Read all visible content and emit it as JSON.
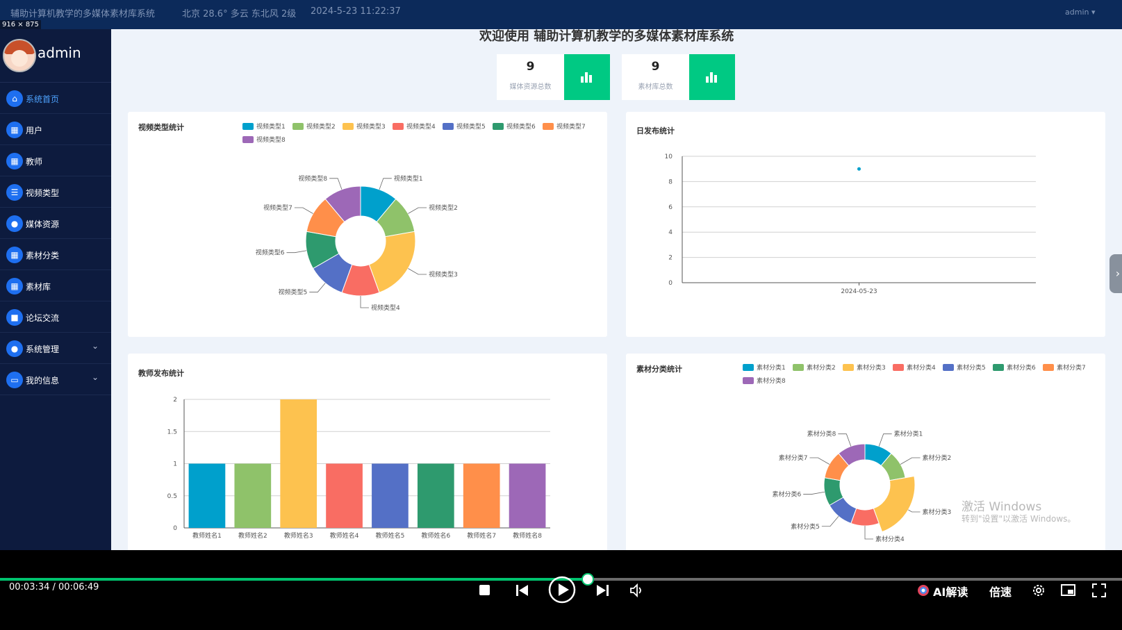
{
  "topbar": {
    "title": "辅助计算机教学的多媒体素材库系统",
    "weather": "北京  28.6°  多云  东北风  2级",
    "datetime": "2024-5-23  11:22:37",
    "user_menu": "admin ▾",
    "dimension_label": "916 × 875"
  },
  "sidebar": {
    "username": "admin",
    "items": [
      {
        "label": "系统首页",
        "icon": "home-icon",
        "glyph": "⌂",
        "active": true,
        "expandable": false
      },
      {
        "label": "用户",
        "icon": "grid-icon",
        "glyph": "▦",
        "active": false,
        "expandable": false
      },
      {
        "label": "教师",
        "icon": "grid-icon",
        "glyph": "▦",
        "active": false,
        "expandable": false
      },
      {
        "label": "视频类型",
        "icon": "list-icon",
        "glyph": "☰",
        "active": false,
        "expandable": false
      },
      {
        "label": "媒体资源",
        "icon": "person-icon",
        "glyph": "●",
        "active": false,
        "expandable": false
      },
      {
        "label": "素材分类",
        "icon": "grid-icon",
        "glyph": "▦",
        "active": false,
        "expandable": false
      },
      {
        "label": "素材库",
        "icon": "grid-icon",
        "glyph": "▦",
        "active": false,
        "expandable": false
      },
      {
        "label": "论坛交流",
        "icon": "briefcase-icon",
        "glyph": "■",
        "active": false,
        "expandable": false
      },
      {
        "label": "系统管理",
        "icon": "bulb-icon",
        "glyph": "●",
        "active": false,
        "expandable": true
      },
      {
        "label": "我的信息",
        "icon": "card-icon",
        "glyph": "▭",
        "active": false,
        "expandable": true
      }
    ]
  },
  "main": {
    "welcome": "欢迎使用 辅助计算机教学的多媒体素材库系统",
    "stats": [
      {
        "value": "9",
        "label": "媒体资源总数",
        "icon": "bar-chart-icon"
      },
      {
        "value": "9",
        "label": "素材库总数",
        "icon": "bar-chart-icon"
      }
    ]
  },
  "colors": {
    "palette": [
      "#00a0cc",
      "#8fc26a",
      "#fdc24f",
      "#f96d63",
      "#5470c6",
      "#2e9a6e",
      "#ff8f4a",
      "#9d68b7"
    ],
    "accent": "#00c983",
    "sidebar_bg": "#0d1b3e",
    "progress": "#00c36e"
  },
  "chart_data": [
    {
      "type": "pie",
      "title": "视频类型统计",
      "categories": [
        "视频类型1",
        "视频类型2",
        "视频类型3",
        "视频类型4",
        "视频类型5",
        "视频类型6",
        "视频类型7",
        "视频类型8"
      ],
      "values": [
        1,
        1,
        2,
        1,
        1,
        1,
        1,
        1
      ],
      "donut": true,
      "legend": "top"
    },
    {
      "type": "scatter",
      "title": "日发布统计",
      "x": [
        "2024-05-23"
      ],
      "values": [
        9
      ],
      "ylim": [
        0,
        10
      ],
      "yticks": [
        0,
        2,
        4,
        6,
        8,
        10
      ],
      "grid": true
    },
    {
      "type": "bar",
      "title": "教师发布统计",
      "categories": [
        "教师姓名1",
        "教师姓名2",
        "教师姓名3",
        "教师姓名4",
        "教师姓名5",
        "教师姓名6",
        "教师姓名7",
        "教师姓名8"
      ],
      "values": [
        1,
        1,
        2,
        1,
        1,
        1,
        1,
        1
      ],
      "ylim": [
        0,
        2
      ],
      "yticks": [
        "0",
        "0.5",
        "1",
        "1.5",
        "2"
      ],
      "grid": true
    },
    {
      "type": "pie",
      "title": "素材分类统计",
      "categories": [
        "素材分类1",
        "素材分类2",
        "素材分类3",
        "素材分类4",
        "素材分类5",
        "素材分类6",
        "素材分类7",
        "素材分类8"
      ],
      "values": [
        1,
        1,
        2,
        1,
        1,
        1,
        1,
        1
      ],
      "donut": true,
      "legend": "top",
      "highlighted": "素材分类3"
    }
  ],
  "watermark": {
    "line1": "激活 Windows",
    "line2": "转到\"设置\"以激活 Windows。"
  },
  "player": {
    "time": "00:03:34 / 00:06:49",
    "progress": 0.524,
    "ai_label": "AI解读",
    "speed_label": "倍速"
  }
}
